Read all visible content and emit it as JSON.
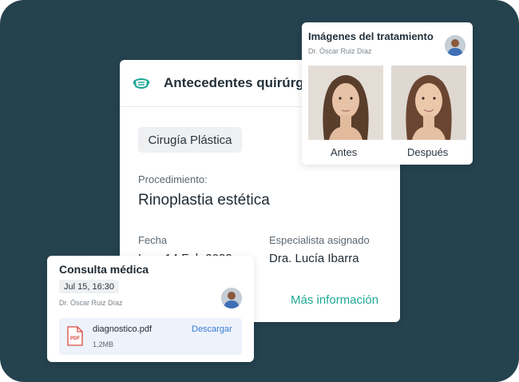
{
  "colors": {
    "background": "#25424f",
    "accent": "#1ea896",
    "link": "#3a7bd5",
    "pdf": "#d94a3d"
  },
  "surgical_history": {
    "title": "Antecedentes quirúrgicos",
    "icon": "surgical-mask-icon",
    "specialty_chip": "Cirugía Plástica",
    "procedure_label": "Procedimiento:",
    "procedure_value": "Rinoplastia estética",
    "date_label": "Fecha",
    "date_value": "Lun, 14 Feb 2022",
    "specialist_label": "Especialista asignado",
    "specialist_value": "Dra. Lucía Ibarra",
    "more_link": "Más información"
  },
  "treatment_images": {
    "title": "Imágenes del tratamiento",
    "doctor": "Dr. Óscar Ruiz Díaz",
    "before_caption": "Antes",
    "after_caption": "Después"
  },
  "consultation": {
    "title": "Consulta médica",
    "datetime": "Jul 15, 16:30",
    "doctor": "Dr. Óscar Ruiz Díaz",
    "file_name": "diagnostico.pdf",
    "file_size": "1,2MB",
    "file_icon_text": "PDF",
    "download_label": "Descargar"
  }
}
